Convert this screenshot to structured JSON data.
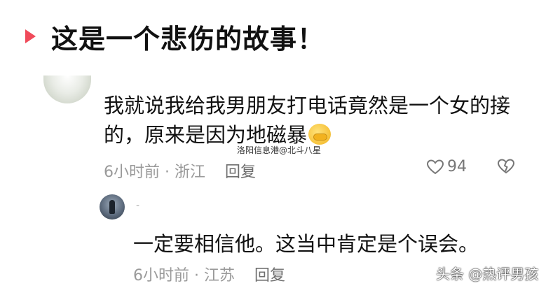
{
  "post": {
    "title": "这是一个悲伤的故事！"
  },
  "comment": {
    "text": "我就说我给我男朋友打电话竟然是一个女的接的，原来是因为地磁暴",
    "time": "6小时前 · 浙江",
    "reply_label": "回复",
    "likes": "94",
    "emoji": "face-palm-emoji"
  },
  "overlay": {
    "watermark": "洛阳信息港@北斗八星",
    "source": "头条 @热评男孩"
  },
  "reply": {
    "username": "-",
    "text": "一定要相信他。这当中肯定是个误会。",
    "time": "6小时前 · 江苏",
    "reply_label": "回复"
  },
  "colors": {
    "accent": "#f04a5a",
    "meta_text": "#9a9a9a"
  }
}
